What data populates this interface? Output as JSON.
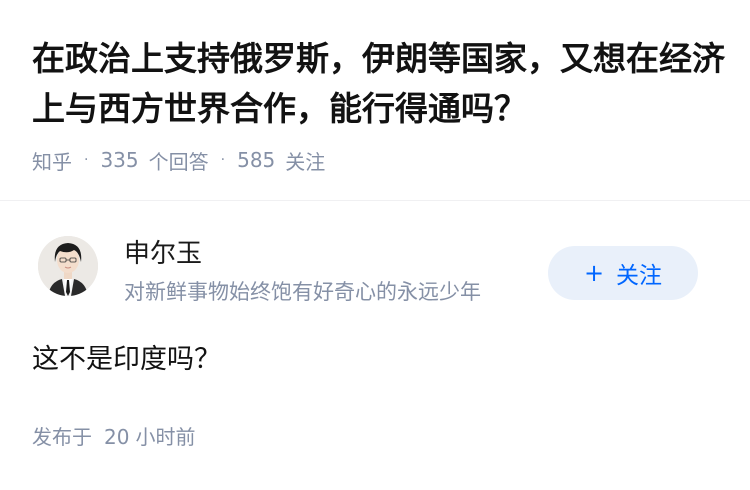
{
  "question": {
    "title": "在政治上支持俄罗斯，伊朗等国家，又想在经济上与西方世界合作，能行得通吗？"
  },
  "meta": {
    "source": "知乎",
    "separator": "·",
    "answer_count": "335",
    "answer_label": "个回答",
    "follow_count": "585",
    "follow_label": "关注"
  },
  "author": {
    "name": "申尔玉",
    "bio": "对新鲜事物始终饱有好奇心的永远少年",
    "follow_plus": "+",
    "follow_label": "关注"
  },
  "answer": {
    "text": "这不是印度吗？"
  },
  "publish": {
    "prefix": "发布于",
    "number": "20",
    "unit": "小时前"
  },
  "colors": {
    "meta_gray": "#8590a6",
    "follow_bg": "#e9f0fa",
    "follow_text": "#0066ff"
  },
  "icons": {
    "avatar": "user-avatar-photo"
  }
}
